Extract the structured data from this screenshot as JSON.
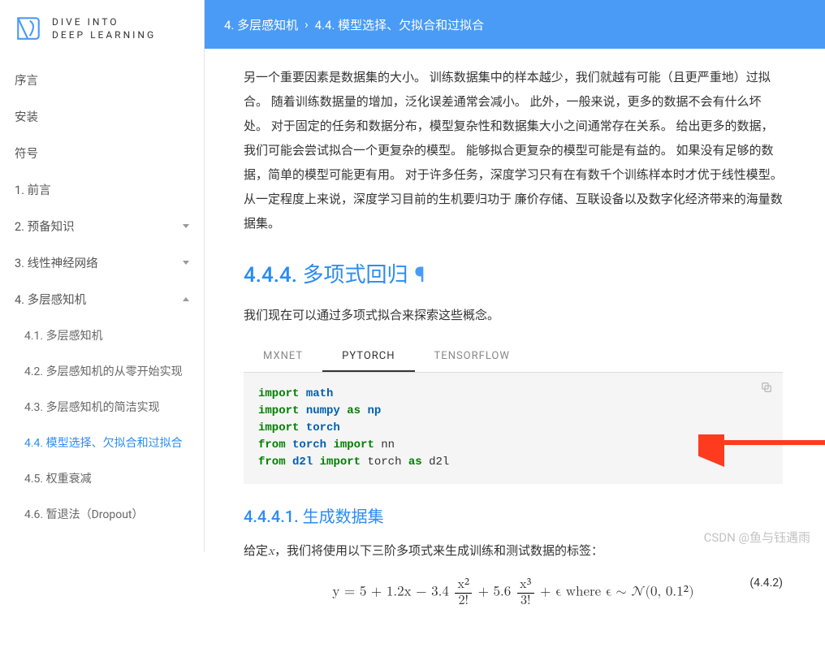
{
  "logo": {
    "line1": "DIVE INTO",
    "line2": "DEEP LEARNING"
  },
  "breadcrumb": {
    "parent": "4. 多层感知机",
    "sep": "›",
    "current": "4.4. 模型选择、欠拟合和过拟合"
  },
  "sidebar": {
    "items": [
      {
        "label": "序言",
        "type": "plain"
      },
      {
        "label": "安装",
        "type": "plain"
      },
      {
        "label": "符号",
        "type": "plain"
      },
      {
        "label": "1. 前言",
        "type": "chapter"
      },
      {
        "label": "2. 预备知识",
        "type": "chapter",
        "arrow": "down"
      },
      {
        "label": "3. 线性神经网络",
        "type": "chapter",
        "arrow": "down"
      },
      {
        "label": "4. 多层感知机",
        "type": "chapter",
        "arrow": "up"
      }
    ],
    "children4": [
      {
        "label": "4.1. 多层感知机"
      },
      {
        "label": "4.2. 多层感知机的从零开始实现"
      },
      {
        "label": "4.3. 多层感知机的简洁实现"
      },
      {
        "label": "4.4. 模型选择、欠拟合和过拟合",
        "active": true
      },
      {
        "label": "4.5. 权重衰减"
      },
      {
        "label": "4.6. 暂退法（Dropout）"
      }
    ]
  },
  "para1": "另一个重要因素是数据集的大小。 训练数据集中的样本越少，我们就越有可能（且更严重地）过拟合。 随着训练数据量的增加，泛化误差通常会减小。 此外，一般来说，更多的数据不会有什么坏处。 对于固定的任务和数据分布，模型复杂性和数据集大小之间通常存在关系。 给出更多的数据，我们可能会尝试拟合一个更复杂的模型。 能够拟合更复杂的模型可能是有益的。 如果没有足够的数据，简单的模型可能更有用。 对于许多任务，深度学习只有在有数千个训练样本时才优于线性模型。 从一定程度上来说，深度学习目前的生机要归功于 廉价存储、互联设备以及数字化经济带来的海量数据集。",
  "h444": "4.4.4. 多项式回归",
  "para2": "我们现在可以通过多项式拟合来探索这些概念。",
  "tabs": {
    "mxnet": "MXNET",
    "pytorch": "PYTORCH",
    "tensorflow": "TENSORFLOW"
  },
  "code": {
    "l1": {
      "kw": "import",
      "nm": "math"
    },
    "l2": {
      "kw": "import",
      "nm": "numpy",
      "as": "as",
      "al": "np"
    },
    "l3": {
      "kw": "import",
      "nm": "torch"
    },
    "l4": {
      "kw1": "from",
      "mod": "torch",
      "kw2": "import",
      "id": "nn"
    },
    "l5": {
      "kw1": "from",
      "mod": "d2l",
      "kw2": "import",
      "id": "torch",
      "as": "as",
      "al": "d2l"
    }
  },
  "h4441": "4.4.4.1. 生成数据集",
  "para3a": "给定",
  "para3x": "x",
  "para3b": "，我们将使用以下三阶多项式来生成训练和测试数据的标签：",
  "eq": {
    "body": "y = 5 + 1.2x − 3.4",
    "f1n": "x²",
    "f1d": "2!",
    "mid": "+ 5.6",
    "f2n": "x³",
    "f2d": "3!",
    "tail": "+ ϵ where ϵ ∼ 𝒩(0, 0.1²)",
    "num": "(4.4.2)"
  },
  "watermark": "CSDN @鱼与钰遇雨"
}
